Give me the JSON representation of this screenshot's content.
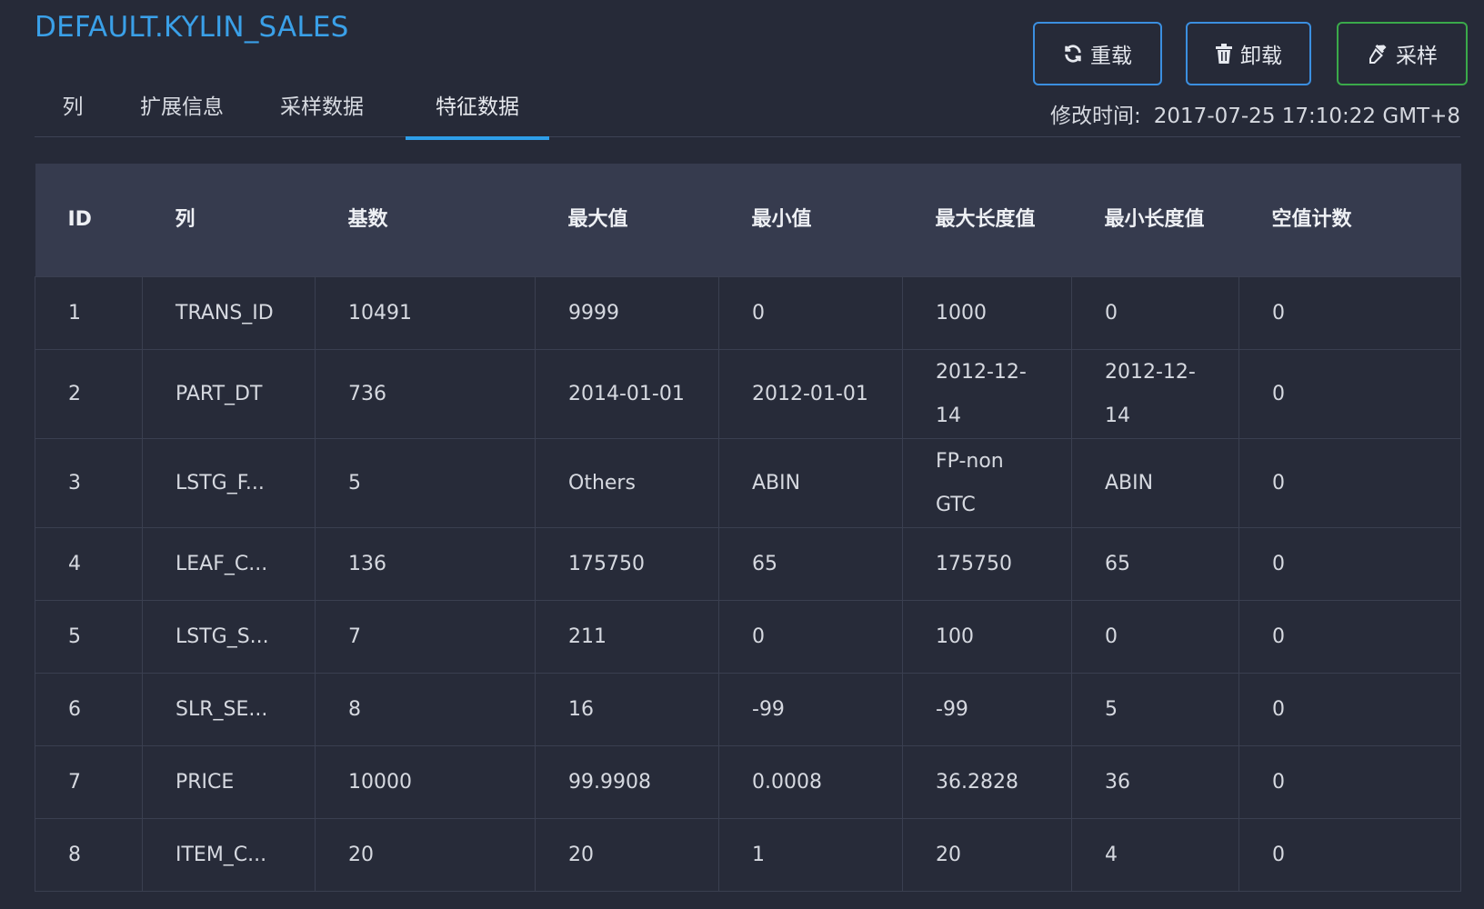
{
  "header": {
    "title": "DEFAULT.KYLIN_SALES"
  },
  "tabs": [
    {
      "label": "列"
    },
    {
      "label": "扩展信息"
    },
    {
      "label": "采样数据"
    },
    {
      "label": "特征数据",
      "active": true
    }
  ],
  "actions": {
    "reload_label": "重载",
    "unload_label": "卸载",
    "sample_label": "采样"
  },
  "modified": {
    "label": "修改时间:",
    "value": "2017-07-25 17:10:22 GMT+8"
  },
  "table": {
    "columns": [
      "ID",
      "列",
      "基数",
      "最大值",
      "最小值",
      "最大长度值",
      "最小长度值",
      "空值计数"
    ],
    "rows": [
      [
        "1",
        "TRANS_ID",
        "10491",
        "9999",
        "0",
        "1000",
        "0",
        "0"
      ],
      [
        "2",
        "PART_DT",
        "736",
        "2014-01-01",
        "2012-01-01",
        "2012-12-14",
        "2012-12-14",
        "0"
      ],
      [
        "3",
        "LSTG_F...",
        "5",
        "Others",
        "ABIN",
        "FP-non GTC",
        "ABIN",
        "0"
      ],
      [
        "4",
        "LEAF_C...",
        "136",
        "175750",
        "65",
        "175750",
        "65",
        "0"
      ],
      [
        "5",
        "LSTG_S...",
        "7",
        "211",
        "0",
        "100",
        "0",
        "0"
      ],
      [
        "6",
        "SLR_SE...",
        "8",
        "16",
        "-99",
        "-99",
        "5",
        "0"
      ],
      [
        "7",
        "PRICE",
        "10000",
        "99.9908",
        "0.0008",
        "36.2828",
        "36",
        "0"
      ],
      [
        "8",
        "ITEM_C...",
        "20",
        "20",
        "1",
        "20",
        "4",
        "0"
      ]
    ]
  },
  "colors": {
    "background": "#262a38",
    "accent": "#2e9ee8",
    "sample_button_border": "#3aa94a"
  }
}
